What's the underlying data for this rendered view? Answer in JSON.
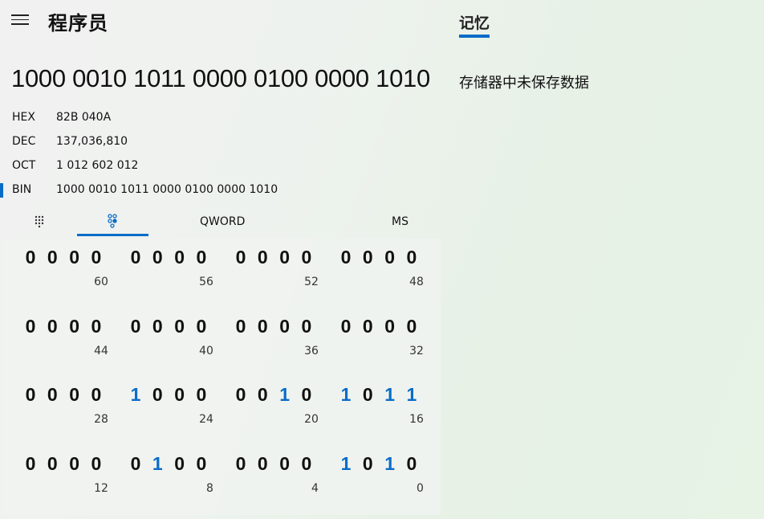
{
  "header": {
    "title": "程序员",
    "menu_icon": "hamburger-menu-icon"
  },
  "memory": {
    "tab_label": "记忆",
    "empty_text": "存储器中未保存数据"
  },
  "display": {
    "value": "1000 0010 1011 0000 0100 0000 1010"
  },
  "radix": [
    {
      "label": "HEX",
      "value": "82B 040A",
      "selected": false
    },
    {
      "label": "DEC",
      "value": "137,036,810",
      "selected": false
    },
    {
      "label": "OCT",
      "value": "1 012 602 012",
      "selected": false
    },
    {
      "label": "BIN",
      "value": "1000 0010 1011 0000 0100 0000 1010",
      "selected": true
    }
  ],
  "toolbar": {
    "keypad_icon": "full-keypad-icon",
    "bitflip_icon": "bit-toggle-keypad-icon",
    "word_size": "QWORD",
    "memory_store": "MS"
  },
  "colors": {
    "accent": "#0a6cc8"
  },
  "bit_rows": [
    {
      "groups": [
        "0000",
        "0000",
        "0000",
        "0000"
      ],
      "positions": [
        "60",
        "56",
        "52",
        "48"
      ]
    },
    {
      "groups": [
        "0000",
        "0000",
        "0000",
        "0000"
      ],
      "positions": [
        "44",
        "40",
        "36",
        "32"
      ]
    },
    {
      "groups": [
        "0000",
        "1000",
        "0010",
        "1011"
      ],
      "positions": [
        "28",
        "24",
        "20",
        "16"
      ]
    },
    {
      "groups": [
        "0000",
        "0100",
        "0000",
        "1010"
      ],
      "positions": [
        "12",
        "8",
        "4",
        "0"
      ]
    }
  ]
}
